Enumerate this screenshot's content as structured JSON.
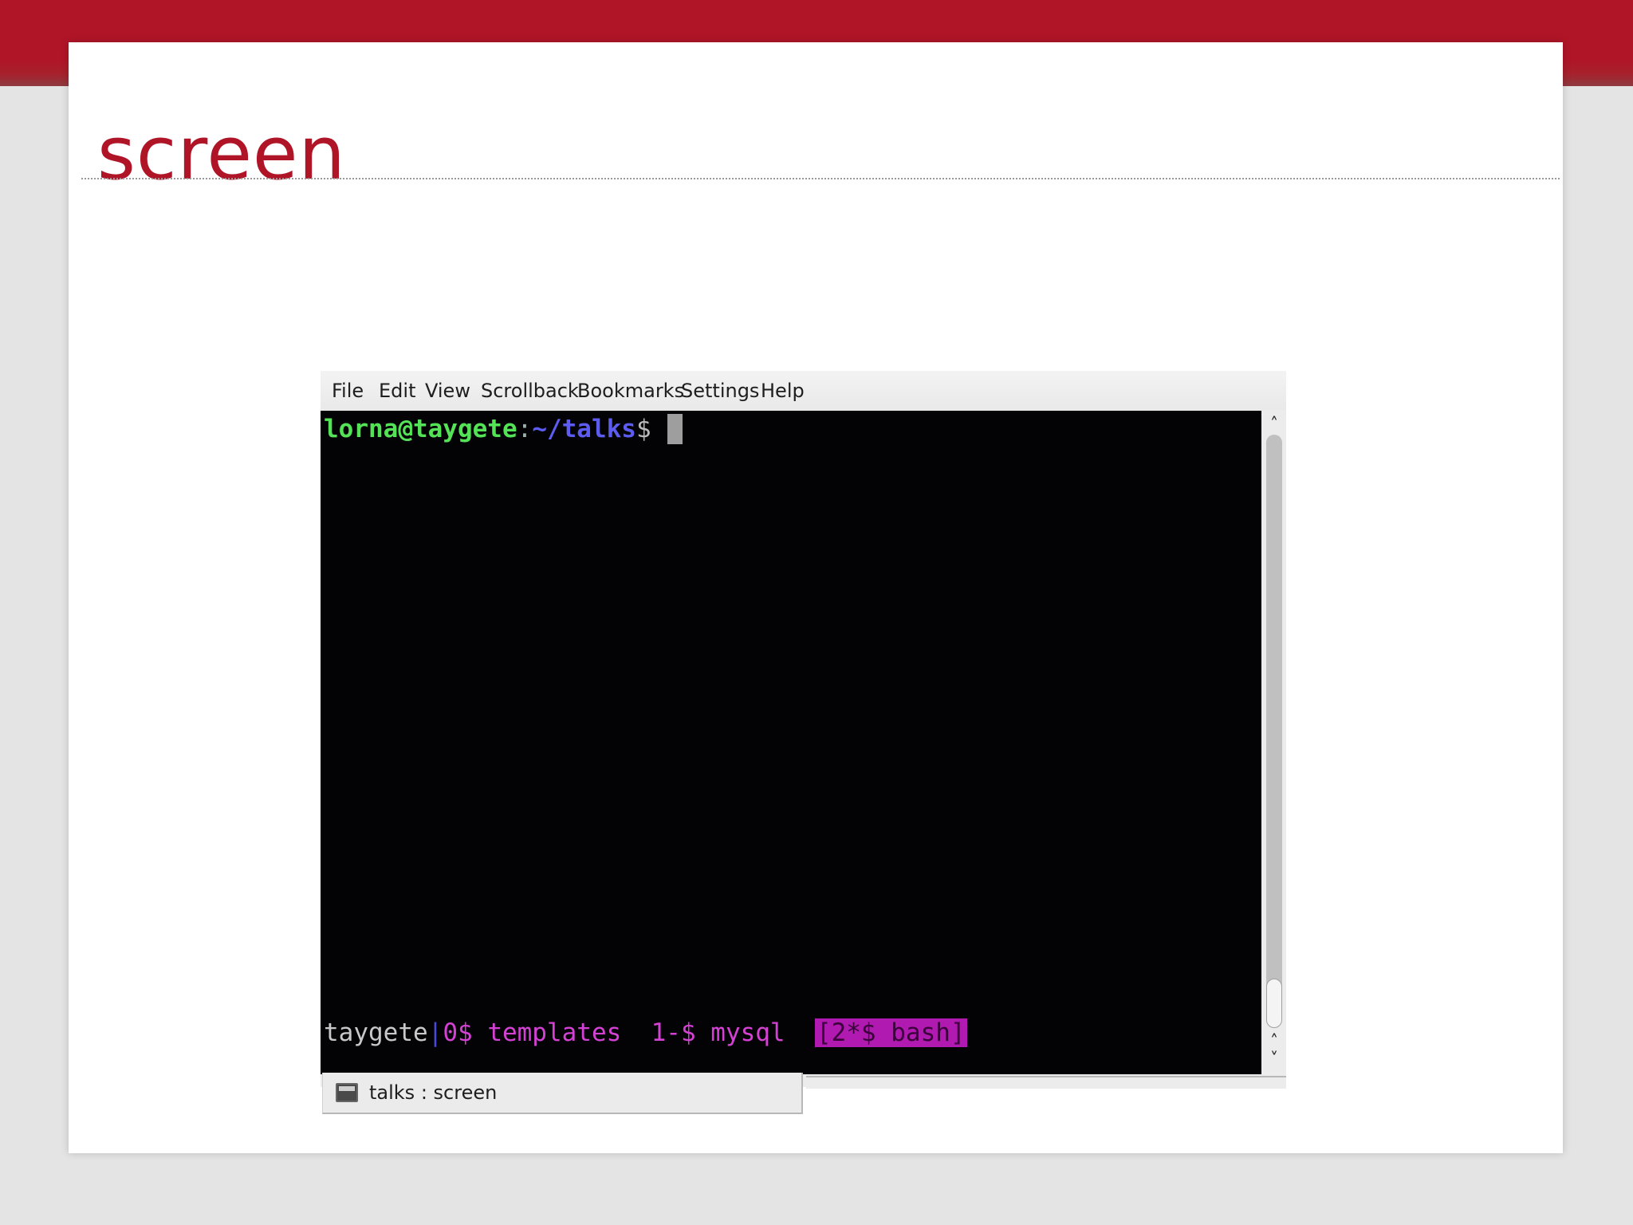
{
  "slide": {
    "title": "screen"
  },
  "konsole": {
    "menu": [
      "File",
      "Edit",
      "View",
      "Scrollback",
      "Bookmarks",
      "Settings",
      "Help"
    ],
    "prompt": {
      "user_host": "lorna@taygete",
      "separator": ":",
      "path": "~/talks",
      "dollar": "$ "
    },
    "status_bar": {
      "host": "taygete",
      "bar": "|",
      "window_0": "0$ templates",
      "window_1": "1-$ mysql",
      "window_2_active": "[2*$ bash]"
    },
    "tab": {
      "icon": "terminal-icon",
      "label": "talks : screen"
    },
    "scrollbar": {
      "up": "scroll-up-icon",
      "down": "scroll-down-icon"
    }
  },
  "colors": {
    "brand_red": "#b01527",
    "terminal_bg": "#030305",
    "prompt_user": "#54e356",
    "prompt_path": "#5c5cf0",
    "screen_window": "#d441d4",
    "screen_active_bg": "#b01ab0"
  }
}
